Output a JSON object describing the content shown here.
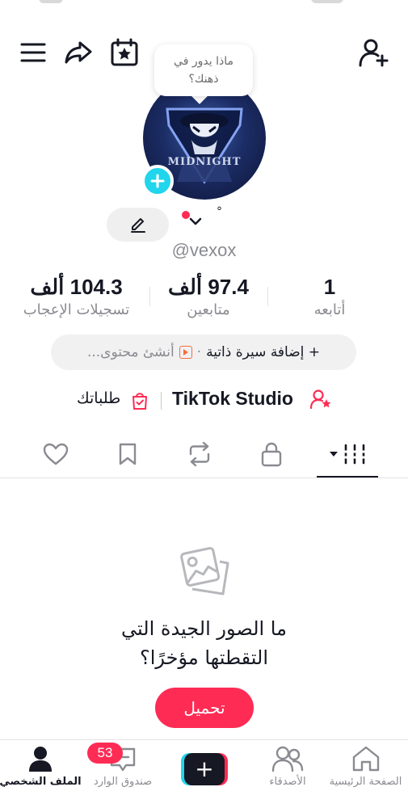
{
  "header": {
    "bubble_line1": "ماذا يدور في",
    "bubble_line2": "ذهنك؟",
    "avatar_text": "MIDNIGHT"
  },
  "profile": {
    "degree_mark": "°",
    "username": "@vexox"
  },
  "stats": [
    {
      "value": "104.3 ألف",
      "label": "تسجيلات الإعجاب"
    },
    {
      "value": "97.4 ألف",
      "label": "متابعين"
    },
    {
      "value": "1",
      "label": "أتابعه"
    }
  ],
  "bio": {
    "add_bio": "+ إضافة سيرة ذاتية",
    "separator": "·",
    "create_content": "أنشئ محتوى..."
  },
  "links": {
    "studio": "TikTok Studio",
    "orders": "طلباتك"
  },
  "empty_state": {
    "line1": "ما الصور الجيدة التي",
    "line2": "التقطتها مؤخرًا؟",
    "upload_label": "تحميل"
  },
  "bottom_nav": {
    "profile": "الملف الشخصي",
    "inbox": "صندوق الوارد",
    "inbox_badge": "53",
    "create": "+",
    "friends": "الأصدقاء",
    "home": "الصفحة الرئيسية"
  },
  "colors": {
    "accent_red": "#fe2c55",
    "accent_cyan": "#20d5ec",
    "text_primary": "#161823",
    "text_secondary": "#8a8b91"
  }
}
